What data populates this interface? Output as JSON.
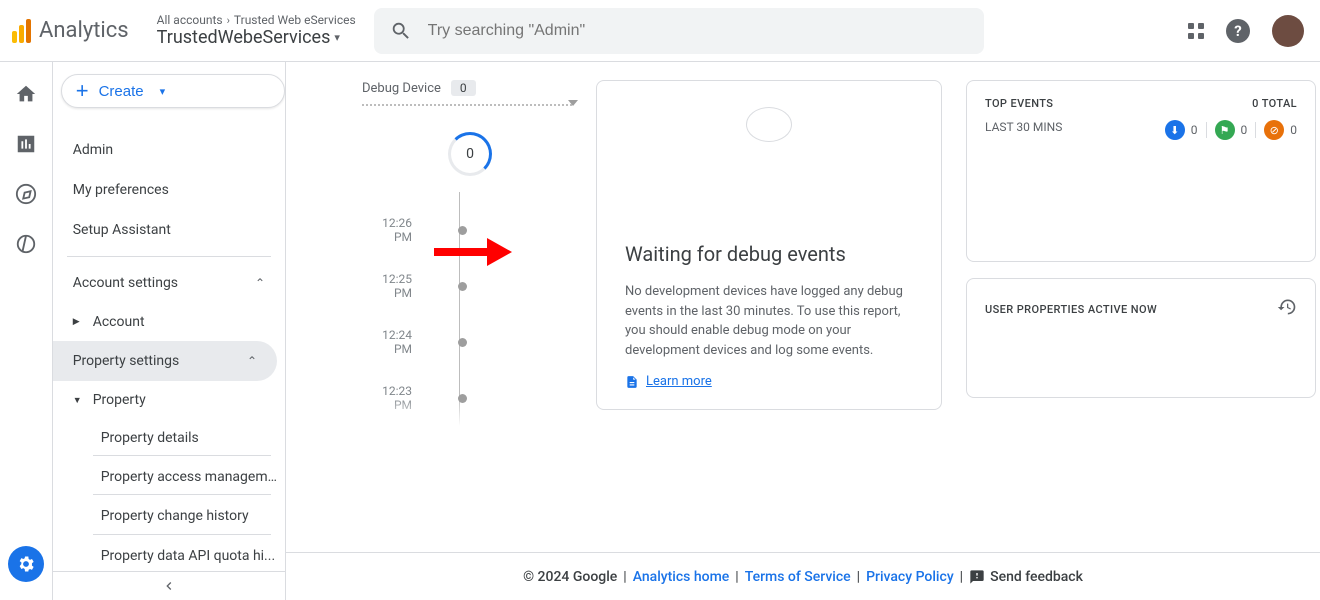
{
  "header": {
    "product": "Analytics",
    "breadcrumb_root": "All accounts",
    "breadcrumb_account": "Trusted Web eServices",
    "property_name": "TrustedWebeServices",
    "search_placeholder": "Try searching \"Admin\""
  },
  "sidebar": {
    "create_label": "Create",
    "items": [
      "Admin",
      "My preferences",
      "Setup Assistant"
    ],
    "account_settings_label": "Account settings",
    "account_label": "Account",
    "property_settings_label": "Property settings",
    "property_label": "Property",
    "property_children": [
      "Property details",
      "Property access managem...",
      "Property change history",
      "Property data API quota hi..."
    ]
  },
  "main": {
    "debug_device_label": "Debug Device",
    "debug_device_count": "0",
    "ring_count": "0",
    "timeline": [
      "12:26 PM",
      "12:25 PM",
      "12:24 PM",
      "12:23 PM"
    ],
    "wait_title": "Waiting for debug events",
    "wait_text": "No development devices have logged any debug events in the last 30 minutes. To use this report, you should enable debug mode on your development devices and log some events.",
    "learn_more": "Learn more",
    "top_events": {
      "title": "TOP EVENTS",
      "total_label": "0 TOTAL",
      "subtitle": "LAST 30 MINS",
      "counts": [
        "0",
        "0",
        "0"
      ]
    },
    "user_props_title": "USER PROPERTIES ACTIVE NOW"
  },
  "footer": {
    "copyright": "© 2024 Google",
    "links": [
      "Analytics home",
      "Terms of Service",
      "Privacy Policy"
    ],
    "feedback": "Send feedback"
  }
}
